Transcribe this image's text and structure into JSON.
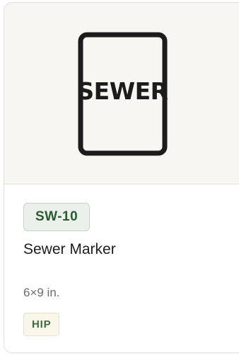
{
  "product": {
    "sign_text": "SEWER",
    "code": "SW-10",
    "title": "Sewer Marker",
    "size": "6×9 in.",
    "material": "HIP"
  },
  "colors": {
    "image_background": "#f8f6f2",
    "code_badge_background": "#eaf1ea",
    "code_badge_text": "#2e5a33",
    "material_badge_background": "#faf6ea",
    "material_badge_text": "#3d6b40"
  }
}
